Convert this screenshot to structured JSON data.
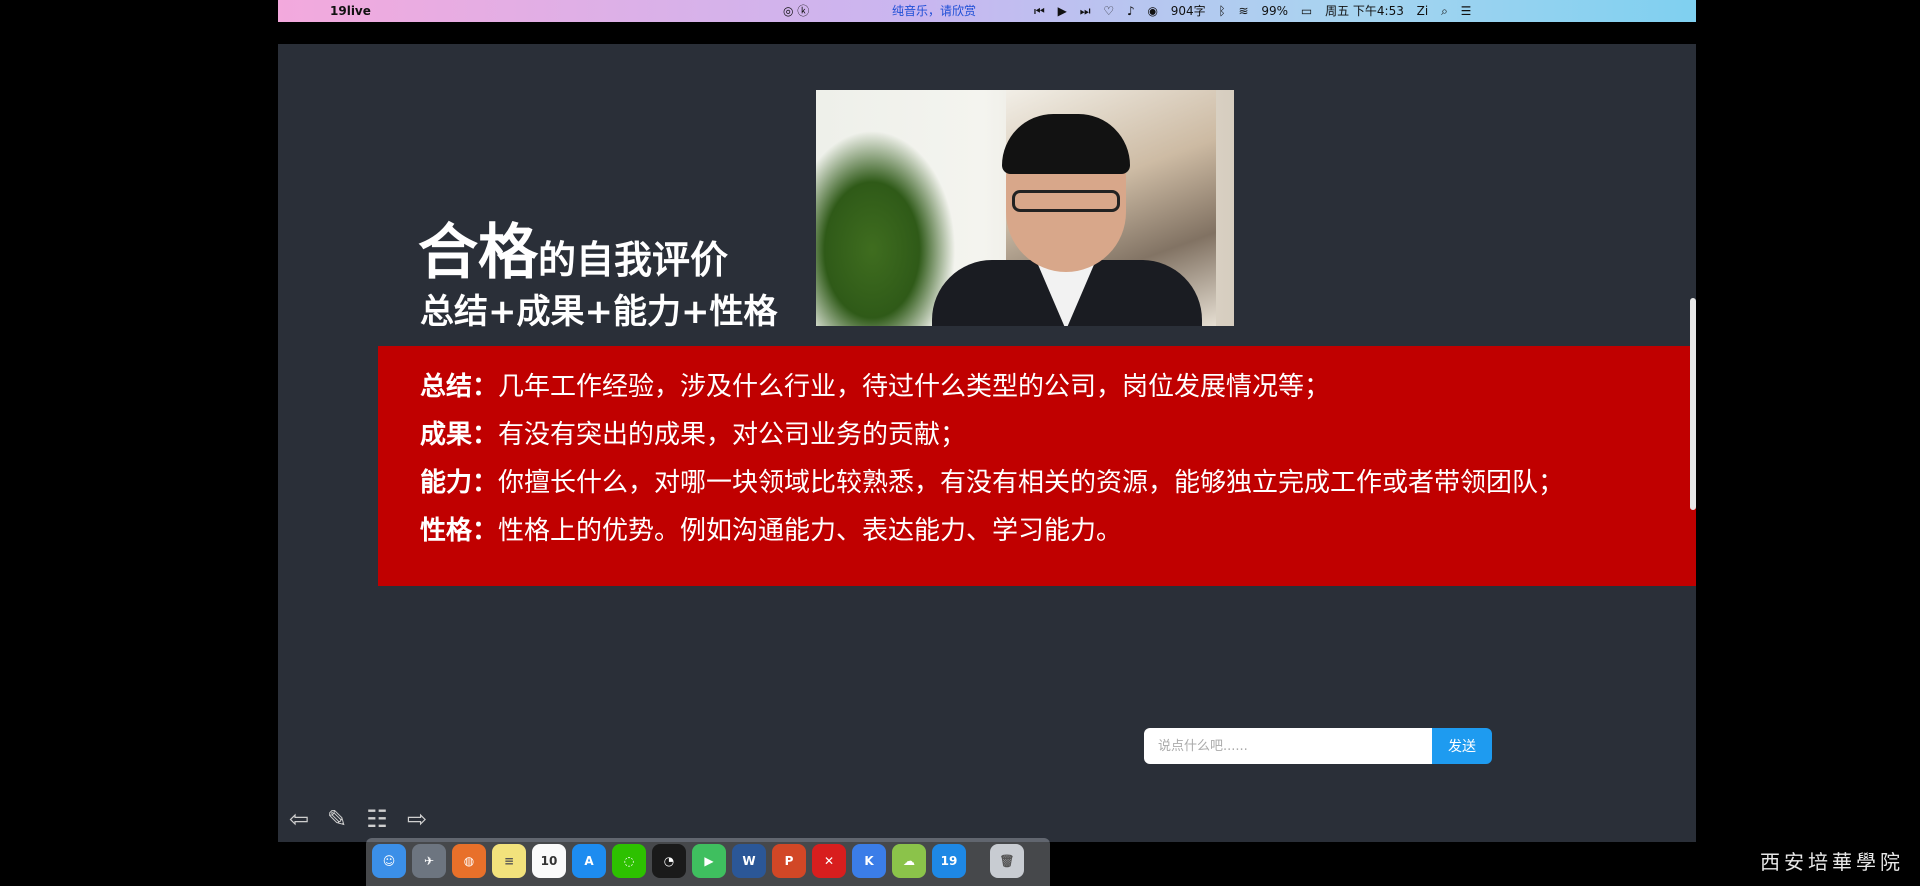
{
  "menubar": {
    "apple_icon": "",
    "app_name": "19live",
    "music_text": "纯音乐，请欣赏",
    "word_count": "904字",
    "battery": "99%",
    "datetime": "周五 下午4:53",
    "input_method": "Zi"
  },
  "slide": {
    "title_big": "合格",
    "title_small": "的自我评价",
    "subtitle": "总结+成果+能力+性格",
    "lines": [
      {
        "label": "总结：",
        "text": "几年工作经验，涉及什么行业，待过什么类型的公司，岗位发展情况等；"
      },
      {
        "label": "成果：",
        "text": "有没有突出的成果，对公司业务的贡献；"
      },
      {
        "label": "能力：",
        "text": "你擅长什么，对哪一块领域比较熟悉，有没有相关的资源，能够独立完成工作或者带领团队；"
      },
      {
        "label": "性格：",
        "text": "性格上的优势。例如沟通能力、表达能力、学习能力。"
      }
    ]
  },
  "toolbar": {
    "prev_icon": "arrow-left-icon",
    "pen_icon": "pencil-icon",
    "notes_icon": "notes-icon",
    "next_icon": "arrow-right-icon"
  },
  "chat": {
    "placeholder": "说点什么吧......",
    "send_label": "发送"
  },
  "dock": {
    "calendar_day": "10",
    "word_label": "W",
    "ppt_label": "P",
    "k_label": "K",
    "live_label": "19"
  },
  "watermark": "西安培華學院",
  "colors": {
    "slide_bg": "#2a2f38",
    "red_box": "#c00000",
    "send_button": "#1e9bf0"
  }
}
